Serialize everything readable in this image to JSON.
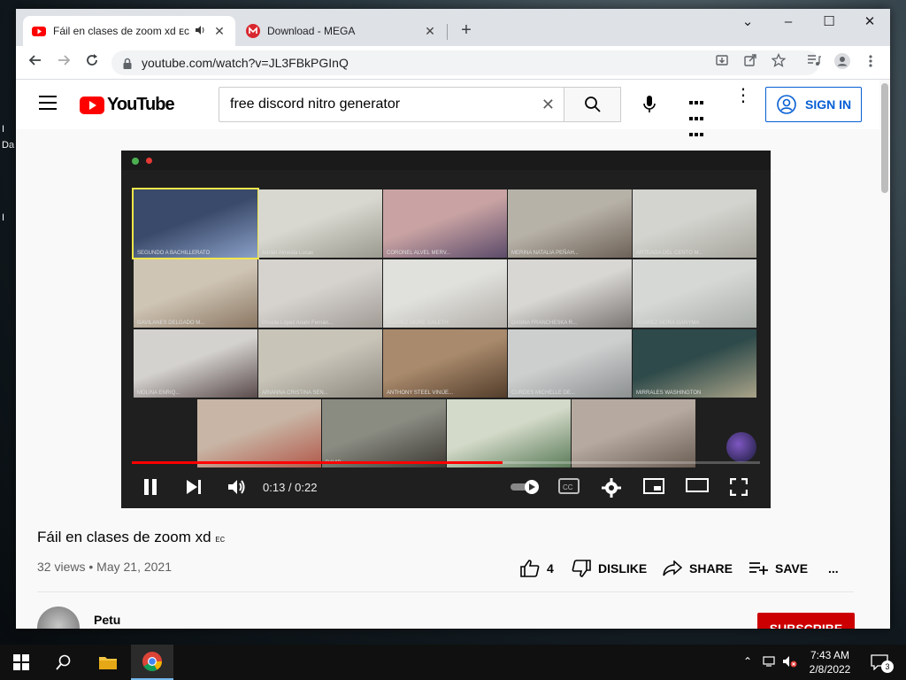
{
  "desktop": {
    "icon_label_1": "I",
    "icon_label_2": "Da",
    "icon_label_3": "I"
  },
  "browser": {
    "tabs": [
      {
        "title": "Fáil en clases de zoom xd ᴇᴄ",
        "favicon": "youtube-icon",
        "active": true,
        "audio": true
      },
      {
        "title": "Download - MEGA",
        "favicon": "mega-icon",
        "active": false
      }
    ],
    "url": "youtube.com/watch?v=JL3FBkPGInQ",
    "window_controls": {
      "chevron": "⌄",
      "minimize": "–",
      "maximize": "☐",
      "close": "✕"
    }
  },
  "youtube": {
    "logo_text": "YouTube",
    "search_value": "free discord nitro generator",
    "sign_in_label": "SIGN IN",
    "player": {
      "current_time": "0:13",
      "duration": "0:22",
      "time_display": "0:13 / 0:22",
      "progress_fraction": 0.59,
      "participant_labels": [
        "SEGUNDO A BACHILLERATO",
        "Adrián Almeida Lucas",
        "CORONEL ALVEL MERV...",
        "MERINA NATALIA PEÑAH...",
        "ARTEAGA DEL CENTO M...",
        "GAVILANES DELGADO M...",
        "Priscila López Anahí Fernán...",
        "SUAREZ MORE GALETH",
        "DANNA FRANCHESKA R...",
        "SUAREZ MORA GANYMA",
        "MOLINA ENRIQ...",
        "ARIANNA CRISTINA SEN...",
        "ANTHONY STEEL VINIJE...",
        "CURDES MICHELLE DE...",
        "MIRRALES WASHINGTON",
        "",
        "DAVID...",
        "",
        ""
      ]
    },
    "video": {
      "title": "Fáil en clases de zoom xd",
      "title_suffix": "ᴇᴄ",
      "views": "32 views",
      "separator": "•",
      "date": "May 21, 2021",
      "like_count": "4",
      "dislike_label": "DISLIKE",
      "share_label": "SHARE",
      "save_label": "SAVE",
      "more_label": "..."
    },
    "channel": {
      "name": "Petu",
      "subscribe_label": "SUBSCRIBE"
    }
  },
  "taskbar": {
    "time": "7:43 AM",
    "date": "2/8/2022",
    "notification_count": "3"
  },
  "colors": {
    "youtube_red": "#ff0000",
    "signin_blue": "#065fd4",
    "subscribe_red": "#cc0000"
  }
}
